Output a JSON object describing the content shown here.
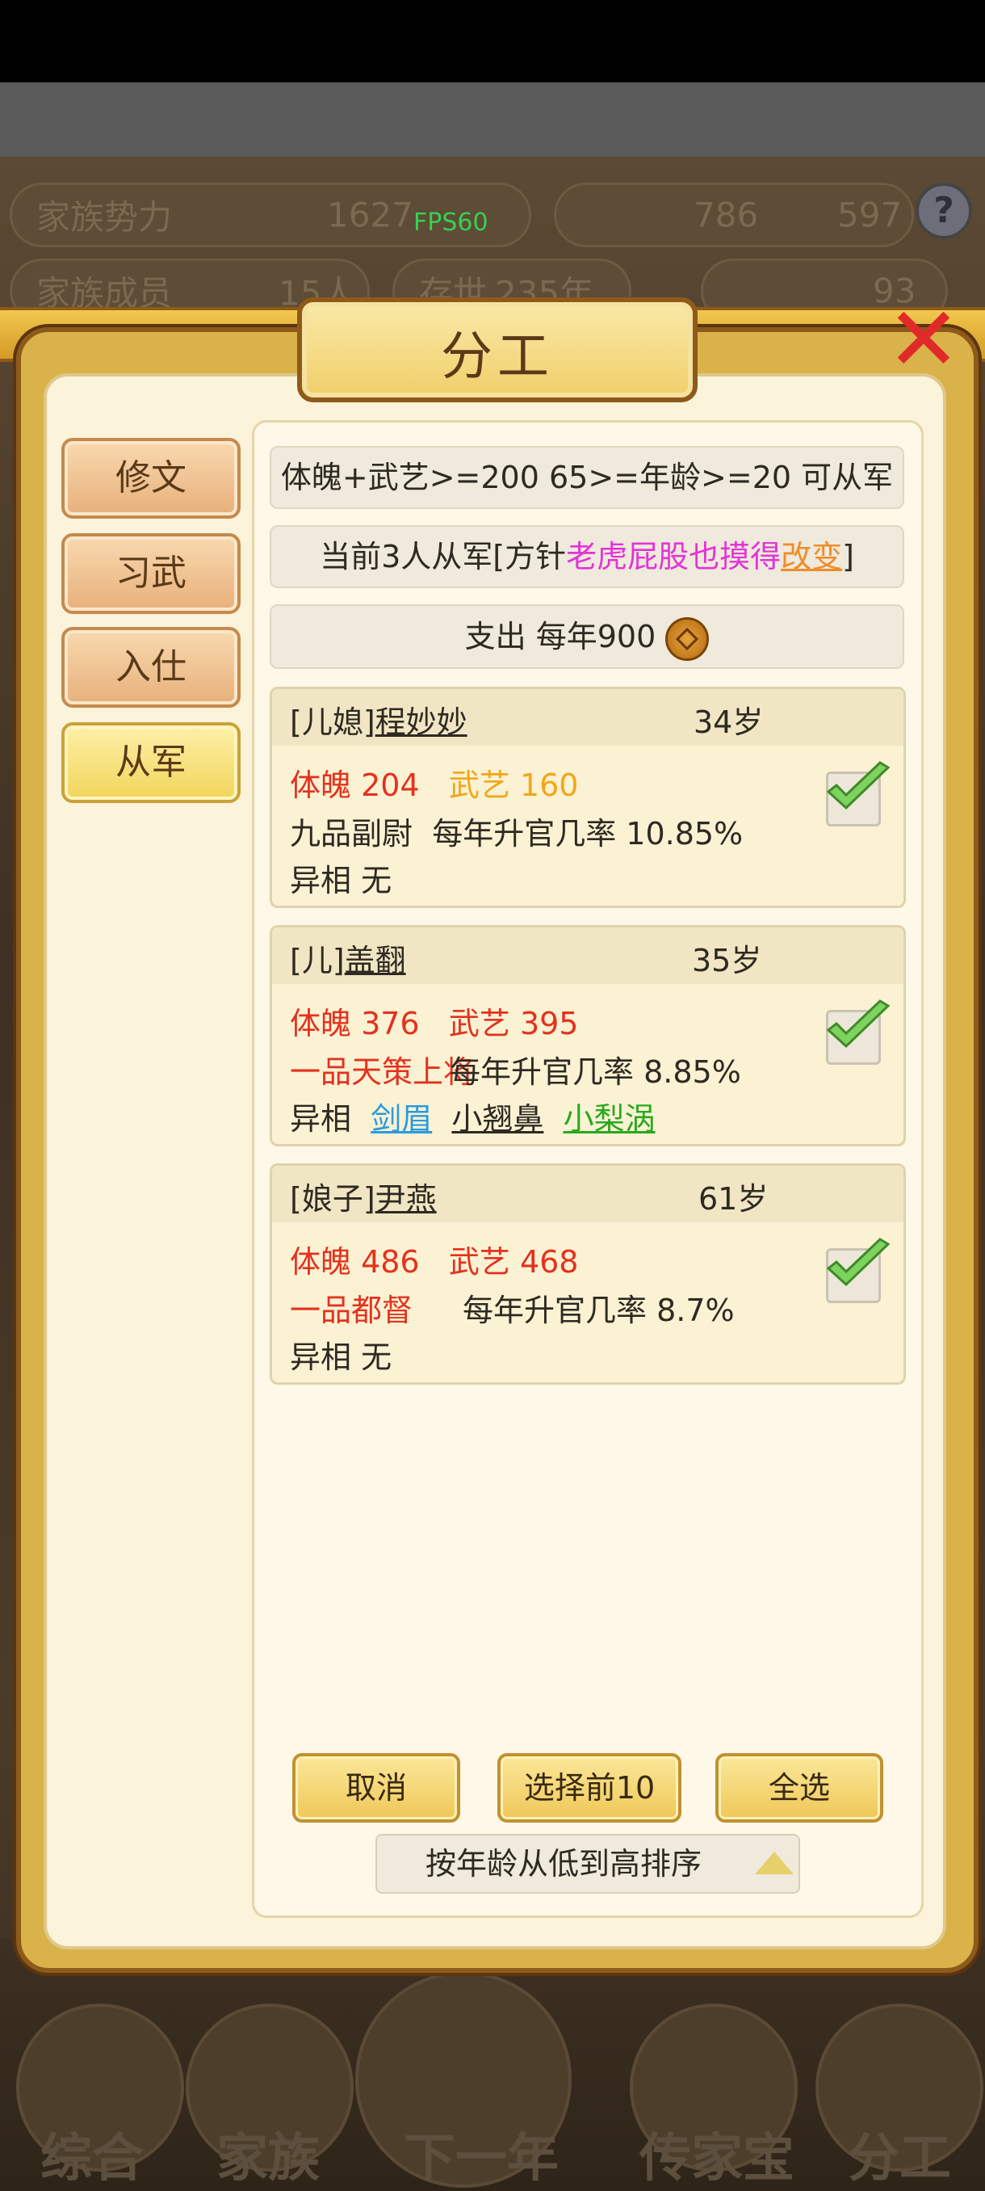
{
  "background": {
    "family_power_label": "家族势力",
    "family_power_value": "1627",
    "family_members_label": "家族成员",
    "family_members_value": "15人",
    "existence_label": "存世",
    "existence_value": "235年",
    "fps": "FPS60",
    "resource1": "786",
    "resource2": "597",
    "gold_value": "93",
    "help_symbol": "?",
    "bottom_nav": [
      "综合",
      "家族",
      "下一年",
      "传家宝",
      "分工"
    ]
  },
  "dialog": {
    "title": "分工",
    "close_symbol": "✕",
    "tabs": [
      "修文",
      "习武",
      "入仕",
      "从军"
    ],
    "active_tab": "从军",
    "requirement": "体魄+武艺>=200 65>=年龄>=20 可从军",
    "status_prefix": "当前3人从军[方针",
    "policy_name": "老虎屁股也摸得",
    "policy_change": "改变",
    "status_suffix": "]",
    "expense_label": "支出 每年900",
    "members": [
      {
        "relation": "[儿媳]",
        "name": "程妙妙",
        "age": "34岁",
        "body_label": "体魄 204",
        "martial_label": "武艺 160",
        "rank": "九品副尉",
        "promotion": "每年升官几率 10.85%",
        "traits_label": "异相",
        "traits": [
          "无"
        ]
      },
      {
        "relation": "[儿]",
        "name": "盖翻",
        "age": "35岁",
        "body_label": "体魄 376",
        "martial_label": "武艺 395",
        "rank": "一品天策上将",
        "promotion": "每年升官几率 8.85%",
        "traits_label": "异相",
        "traits": [
          "剑眉",
          "小翘鼻",
          "小梨涡"
        ]
      },
      {
        "relation": "[娘子]",
        "name": "尹燕",
        "age": "61岁",
        "body_label": "体魄 486",
        "martial_label": "武艺 468",
        "rank": "一品都督",
        "promotion": "每年升官几率 8.7%",
        "traits_label": "异相",
        "traits": [
          "无"
        ]
      }
    ],
    "buttons": {
      "cancel": "取消",
      "select_top10": "选择前10",
      "select_all": "全选"
    },
    "sort_label": "按年龄从低到高排序"
  },
  "colors": {
    "accent_gold": "#f2d55a",
    "stat_red": "#e3321e",
    "stat_gold": "#f2a618",
    "policy_magenta": "#e433d7"
  }
}
